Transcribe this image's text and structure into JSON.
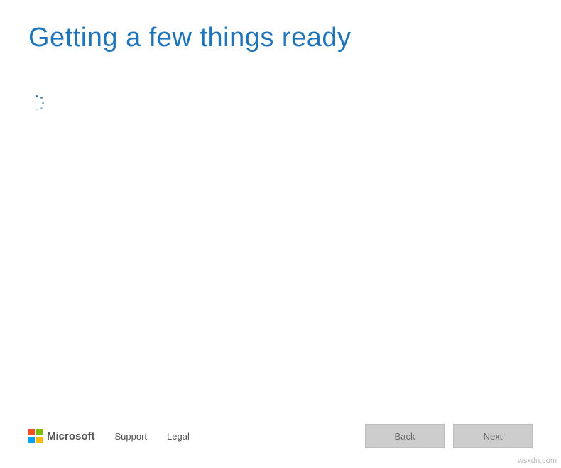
{
  "title": "Getting a few things ready",
  "footer": {
    "brand": "Microsoft",
    "links": {
      "support": "Support",
      "legal": "Legal"
    },
    "buttons": {
      "back": "Back",
      "next": "Next"
    }
  },
  "watermark": "wsxdn.com",
  "colors": {
    "accent": "#1e74bb",
    "button_bg": "#cdcdcd",
    "button_text": "#6a6a6a"
  }
}
